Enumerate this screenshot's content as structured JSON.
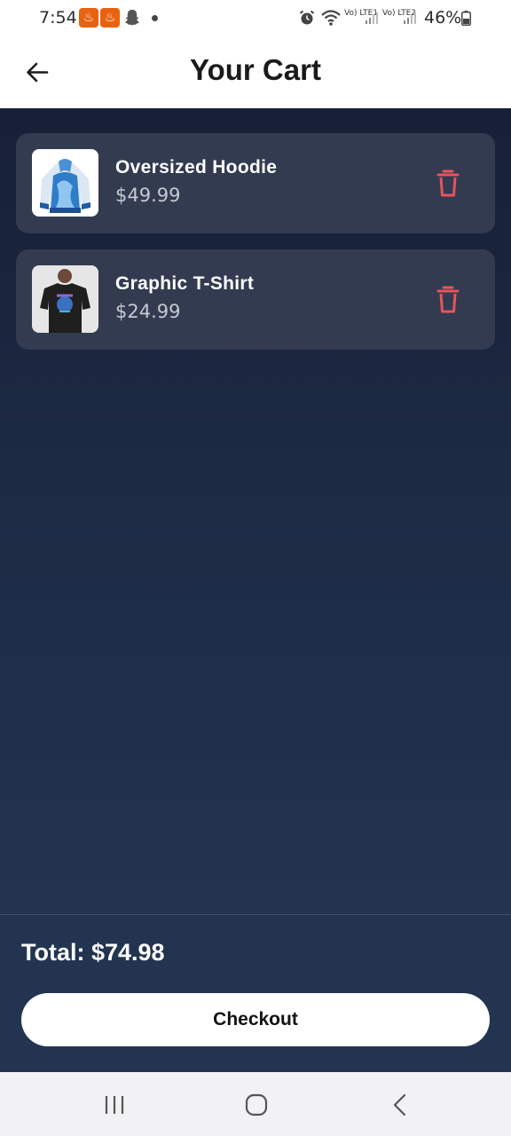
{
  "status_bar": {
    "time": "7:54",
    "lte1_label": "Vo) LTE1",
    "lte2_label": "Vo) LTE2",
    "battery": "46%"
  },
  "header": {
    "title": "Your Cart",
    "back_icon": "arrow-left-icon"
  },
  "cart": {
    "items": [
      {
        "name": "Oversized Hoodie",
        "price": "$49.99",
        "thumbnail": "hoodie-image",
        "delete_icon": "trash-icon"
      },
      {
        "name": "Graphic T-Shirt",
        "price": "$24.99",
        "thumbnail": "tshirt-image",
        "delete_icon": "trash-icon"
      }
    ]
  },
  "footer": {
    "total": "Total: $74.98",
    "checkout_label": "Checkout"
  },
  "colors": {
    "accent_delete": "#e8535d",
    "card_bg": "#323b50",
    "footer_bg": "#22344f"
  }
}
